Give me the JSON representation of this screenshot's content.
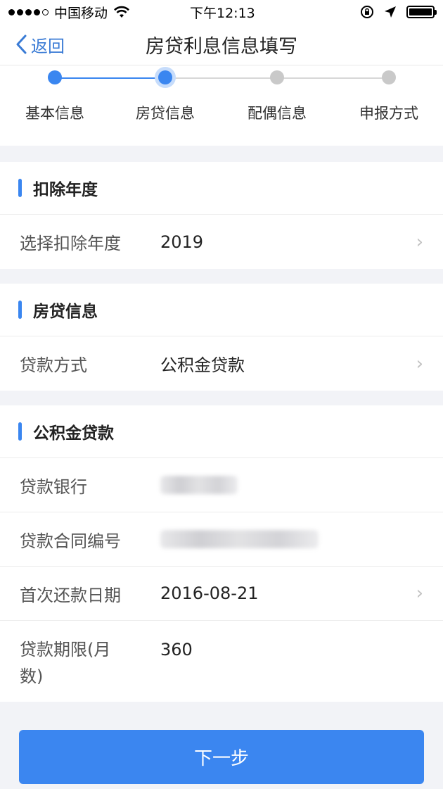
{
  "status_bar": {
    "carrier": "中国移动",
    "time": "下午12:13"
  },
  "nav": {
    "back_label": "返回",
    "title": "房贷利息信息填写"
  },
  "steps": [
    {
      "label": "基本信息",
      "state": "done"
    },
    {
      "label": "房贷信息",
      "state": "current"
    },
    {
      "label": "配偶信息",
      "state": "pending"
    },
    {
      "label": "申报方式",
      "state": "pending"
    }
  ],
  "sections": {
    "year": {
      "title": "扣除年度",
      "rows": [
        {
          "label": "选择扣除年度",
          "value": "2019"
        }
      ]
    },
    "loan": {
      "title": "房贷信息",
      "rows": [
        {
          "label": "贷款方式",
          "value": "公积金贷款"
        }
      ]
    },
    "fund": {
      "title": "公积金贷款",
      "rows": [
        {
          "label": "贷款银行",
          "value": ""
        },
        {
          "label": "贷款合同编号",
          "value": ""
        },
        {
          "label": "首次还款日期",
          "value": "2016-08-21"
        },
        {
          "label": "贷款期限(月数)",
          "value": "360"
        }
      ]
    }
  },
  "actions": {
    "next_label": "下一步"
  },
  "colors": {
    "accent": "#3a86f0",
    "background": "#f2f3f7"
  }
}
